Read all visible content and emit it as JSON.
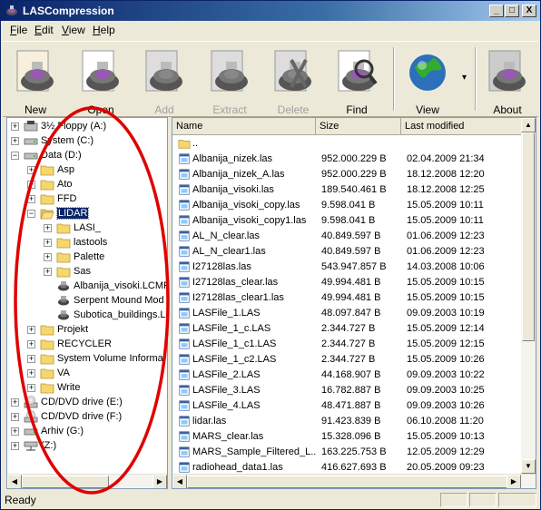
{
  "window": {
    "title": "LASCompression",
    "minimize": "_",
    "maximize": "□",
    "close": "X"
  },
  "menu": [
    {
      "label": "File",
      "u": "F",
      "rest": "ile"
    },
    {
      "label": "Edit",
      "u": "E",
      "rest": "dit"
    },
    {
      "label": "View",
      "u": "V",
      "rest": "iew"
    },
    {
      "label": "Help",
      "u": "H",
      "rest": "elp"
    }
  ],
  "toolbar": [
    {
      "label": "New",
      "icon": "new-icon",
      "enabled": true
    },
    {
      "label": "Open",
      "icon": "open-icon",
      "enabled": true
    },
    {
      "label": "Add",
      "icon": "add-icon",
      "enabled": false
    },
    {
      "label": "Extract",
      "icon": "extract-icon",
      "enabled": false
    },
    {
      "label": "Delete",
      "icon": "delete-icon",
      "enabled": false
    },
    {
      "label": "Find",
      "icon": "find-icon",
      "enabled": true
    },
    {
      "label": "View",
      "icon": "view-icon",
      "enabled": true
    },
    {
      "label": "About",
      "icon": "about-icon",
      "enabled": true
    }
  ],
  "tree": [
    {
      "label": "3½ Floppy (A:)",
      "level": 0,
      "exp": "+",
      "icon": "floppy-icon"
    },
    {
      "label": "System (C:)",
      "level": 0,
      "exp": "+",
      "icon": "drive-icon"
    },
    {
      "label": "Data (D:)",
      "level": 0,
      "exp": "-",
      "icon": "drive-icon"
    },
    {
      "label": "Asp",
      "level": 1,
      "exp": "+",
      "icon": "folder-icon"
    },
    {
      "label": "Ato",
      "level": 1,
      "exp": "+",
      "icon": "folder-icon"
    },
    {
      "label": "FFD",
      "level": 1,
      "exp": "+",
      "icon": "folder-icon"
    },
    {
      "label": "LIDAR",
      "level": 1,
      "exp": "-",
      "icon": "folder-open-icon",
      "selected": true
    },
    {
      "label": "LASI_",
      "level": 2,
      "exp": "+",
      "icon": "folder-icon"
    },
    {
      "label": "lastools",
      "level": 2,
      "exp": "+",
      "icon": "folder-icon"
    },
    {
      "label": "Palette",
      "level": 2,
      "exp": "+",
      "icon": "folder-icon"
    },
    {
      "label": "Sas",
      "level": 2,
      "exp": "+",
      "icon": "folder-icon"
    },
    {
      "label": "Albanija_visoki.LCMP",
      "level": 2,
      "exp": "",
      "icon": "archive-icon"
    },
    {
      "label": "Serpent Mound Mod",
      "level": 2,
      "exp": "",
      "icon": "archive-icon"
    },
    {
      "label": "Subotica_buildings.L",
      "level": 2,
      "exp": "",
      "icon": "archive-icon"
    },
    {
      "label": "Projekt",
      "level": 1,
      "exp": "+",
      "icon": "folder-icon"
    },
    {
      "label": "RECYCLER",
      "level": 1,
      "exp": "+",
      "icon": "folder-icon"
    },
    {
      "label": "System Volume Informa",
      "level": 1,
      "exp": "+",
      "icon": "folder-icon"
    },
    {
      "label": "VA",
      "level": 1,
      "exp": "+",
      "icon": "folder-icon"
    },
    {
      "label": "Write",
      "level": 1,
      "exp": "+",
      "icon": "folder-icon"
    },
    {
      "label": "CD/DVD drive (E:)",
      "level": 0,
      "exp": "+",
      "icon": "cd-icon"
    },
    {
      "label": "CD/DVD drive (F:)",
      "level": 0,
      "exp": "+",
      "icon": "cd-icon"
    },
    {
      "label": "Arhiv (G:)",
      "level": 0,
      "exp": "+",
      "icon": "drive-icon"
    },
    {
      "label": "(Z:)",
      "level": 0,
      "exp": "+",
      "icon": "network-drive-icon"
    }
  ],
  "columns": {
    "name": "Name",
    "size": "Size",
    "modified": "Last modified"
  },
  "files": [
    {
      "name": "..",
      "size": "",
      "date": "",
      "icon": "folder-icon"
    },
    {
      "name": "Albanija_nizek.las",
      "size": "952.000.229 B",
      "date": "02.04.2009 21:34",
      "icon": "las-file-icon"
    },
    {
      "name": "Albanija_nizek_A.las",
      "size": "952.000.229 B",
      "date": "18.12.2008 12:20",
      "icon": "las-file-icon"
    },
    {
      "name": "Albanija_visoki.las",
      "size": "189.540.461 B",
      "date": "18.12.2008 12:25",
      "icon": "las-file-icon"
    },
    {
      "name": "Albanija_visoki_copy.las",
      "size": "9.598.041 B",
      "date": "15.05.2009 10:11",
      "icon": "las-file-icon"
    },
    {
      "name": "Albanija_visoki_copy1.las",
      "size": "9.598.041 B",
      "date": "15.05.2009 10:11",
      "icon": "las-file-icon"
    },
    {
      "name": "AL_N_clear.las",
      "size": "40.849.597 B",
      "date": "01.06.2009 12:23",
      "icon": "las-file-icon"
    },
    {
      "name": "AL_N_clear1.las",
      "size": "40.849.597 B",
      "date": "01.06.2009 12:23",
      "icon": "las-file-icon"
    },
    {
      "name": "I27128las.las",
      "size": "543.947.857 B",
      "date": "14.03.2008 10:06",
      "icon": "las-file-icon"
    },
    {
      "name": "I27128las_clear.las",
      "size": "49.994.481 B",
      "date": "15.05.2009 10:15",
      "icon": "las-file-icon"
    },
    {
      "name": "I27128las_clear1.las",
      "size": "49.994.481 B",
      "date": "15.05.2009 10:15",
      "icon": "las-file-icon"
    },
    {
      "name": "LASFile_1.LAS",
      "size": "48.097.847 B",
      "date": "09.09.2003 10:19",
      "icon": "las-file-icon"
    },
    {
      "name": "LASFile_1_c.LAS",
      "size": "2.344.727 B",
      "date": "15.05.2009 12:14",
      "icon": "las-file-icon"
    },
    {
      "name": "LASFile_1_c1.LAS",
      "size": "2.344.727 B",
      "date": "15.05.2009 12:15",
      "icon": "las-file-icon"
    },
    {
      "name": "LASFile_1_c2.LAS",
      "size": "2.344.727 B",
      "date": "15.05.2009 10:26",
      "icon": "las-file-icon"
    },
    {
      "name": "LASFile_2.LAS",
      "size": "44.168.907 B",
      "date": "09.09.2003 10:22",
      "icon": "las-file-icon"
    },
    {
      "name": "LASFile_3.LAS",
      "size": "16.782.887 B",
      "date": "09.09.2003 10:25",
      "icon": "las-file-icon"
    },
    {
      "name": "LASFile_4.LAS",
      "size": "48.471.887 B",
      "date": "09.09.2003 10:26",
      "icon": "las-file-icon"
    },
    {
      "name": "lidar.las",
      "size": "91.423.839 B",
      "date": "06.10.2008 11:20",
      "icon": "las-file-icon"
    },
    {
      "name": "MARS_clear.las",
      "size": "15.328.096 B",
      "date": "15.05.2009 10:13",
      "icon": "las-file-icon"
    },
    {
      "name": "MARS_Sample_Filtered_L...",
      "size": "163.225.753 B",
      "date": "12.05.2009 12:29",
      "icon": "las-file-icon"
    },
    {
      "name": "radiohead_data1.las",
      "size": "416.627.693 B",
      "date": "20.05.2009 09:23",
      "icon": "las-file-icon"
    }
  ],
  "status": {
    "text": "Ready"
  },
  "colors": {
    "title_start": "#0a246a",
    "title_end": "#a6caf0",
    "selection": "#0a246a",
    "annotation": "#e00000"
  }
}
